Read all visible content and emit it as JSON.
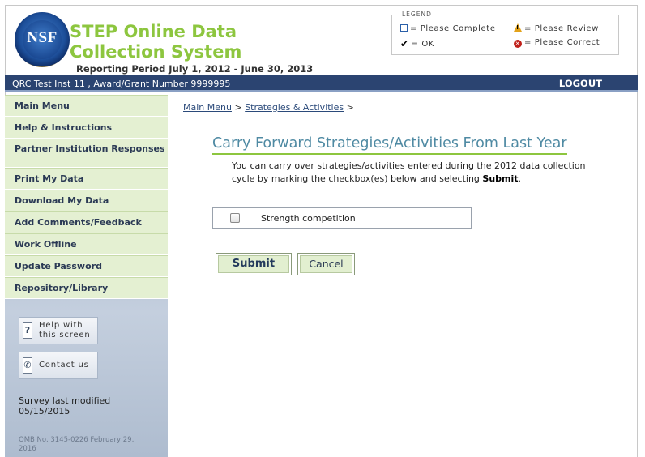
{
  "app": {
    "logo_text": "NSF",
    "title": "STEP Online Data Collection System",
    "reporting_period": "Reporting Period July 1, 2012 - June 30, 2013"
  },
  "legend": {
    "title": "LEGEND",
    "items": [
      {
        "icon": "square-icon",
        "label": "= Please Complete"
      },
      {
        "icon": "warning-icon",
        "label": "= Please Review"
      },
      {
        "icon": "check-icon",
        "label": "= OK"
      },
      {
        "icon": "error-icon",
        "label": "= Please Correct"
      }
    ]
  },
  "bar": {
    "institution": "QRC Test Inst 11 , Award/Grant Number 9999995",
    "logout": "LOGOUT"
  },
  "sidebar": {
    "items": [
      {
        "label": "Main Menu"
      },
      {
        "label": "Help & Instructions"
      },
      {
        "label": "Partner Institution Responses"
      },
      {
        "label": "Print My Data"
      },
      {
        "label": "Download My Data"
      },
      {
        "label": "Add Comments/Feedback"
      },
      {
        "label": "Work Offline"
      },
      {
        "label": "Update Password"
      },
      {
        "label": "Repository/Library"
      }
    ],
    "help_button": "Help with this screen",
    "contact_button": "Contact us",
    "survey_modified": "Survey last modified 05/15/2015",
    "omb": "OMB No. 3145-0226 February 29, 2016"
  },
  "breadcrumb": {
    "home": "Main Menu",
    "sep1": ">",
    "current": "Strategies & Activities",
    "sep2": ">"
  },
  "main": {
    "title": "Carry Forward Strategies/Activities From Last Year",
    "intro_text": "You can carry over strategies/activities entered during the 2012 data collection cycle by marking the checkbox(es) below and selecting",
    "intro_bold": "Submit",
    "intro_end": ".",
    "items": [
      {
        "label": "Strength competition",
        "checked": false
      }
    ],
    "submit": "Submit",
    "cancel": "Cancel"
  },
  "colors": {
    "accent_green": "#8dc63f",
    "bar_blue": "#2b4471",
    "title_teal": "#4f8aa3",
    "menu_bg": "#e4f0d2"
  }
}
